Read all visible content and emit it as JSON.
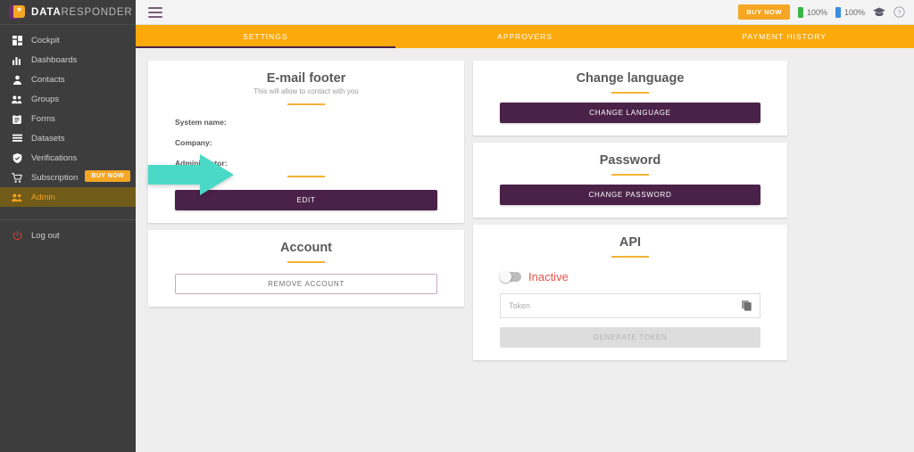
{
  "brand": {
    "name_bold": "DATA",
    "name_light": "RESPONDER",
    "logo_icon": "head-star-logo-icon"
  },
  "sidebar": {
    "items": [
      {
        "label": "Cockpit",
        "icon": "dashboard-grid-icon",
        "active": false
      },
      {
        "label": "Dashboards",
        "icon": "bar-chart-icon",
        "active": false
      },
      {
        "label": "Contacts",
        "icon": "person-icon",
        "active": false
      },
      {
        "label": "Groups",
        "icon": "people-group-icon",
        "active": false
      },
      {
        "label": "Forms",
        "icon": "clipboard-icon",
        "active": false
      },
      {
        "label": "Datasets",
        "icon": "list-lines-icon",
        "active": false
      },
      {
        "label": "Verifications",
        "icon": "shield-check-icon",
        "active": false
      },
      {
        "label": "Subscription",
        "icon": "shopping-cart-icon",
        "active": false,
        "badge": "BUY NOW"
      },
      {
        "label": "Admin",
        "icon": "people-group-icon",
        "active": true
      }
    ],
    "logout": {
      "label": "Log out",
      "icon": "power-icon"
    }
  },
  "topbar": {
    "menu_icon": "hamburger-menu-icon",
    "buy_now_label": "BUY NOW",
    "meters": [
      {
        "value": "100%",
        "color": "#39b54a",
        "icon": "green-battery-icon"
      },
      {
        "value": "100%",
        "color": "#3b8ede",
        "icon": "blue-battery-icon"
      }
    ],
    "graduation_icon": "graduation-cap-icon",
    "help_icon": "help-circle-icon"
  },
  "tabs": [
    {
      "label": "SETTINGS",
      "active": true
    },
    {
      "label": "APPROVERS",
      "active": false
    },
    {
      "label": "PAYMENT HISTORY",
      "active": false
    }
  ],
  "cards": {
    "email_footer": {
      "title": "E-mail footer",
      "subtitle": "This will allow to contact with you",
      "fields": [
        {
          "label": "System name:",
          "value": ""
        },
        {
          "label": "Company:",
          "value": ""
        },
        {
          "label": "Administrator:",
          "value": ""
        }
      ],
      "edit_label": "EDIT"
    },
    "account": {
      "title": "Account",
      "remove_label": "REMOVE ACCOUNT"
    },
    "change_language": {
      "title": "Change language",
      "button_label": "CHANGE LANGUAGE"
    },
    "password": {
      "title": "Password",
      "button_label": "CHANGE PASSWORD"
    },
    "api": {
      "title": "API",
      "toggle_state": "Inactive",
      "toggle_on": false,
      "token_value": "",
      "token_placeholder": "Token",
      "copy_icon": "copy-icon",
      "generate_label": "GENERATE TOKEN",
      "generate_disabled": true
    }
  },
  "annotation": {
    "arrow_icon": "teal-arrow-right-icon",
    "arrow_color": "#4ad9c6",
    "points_at": "EDIT"
  },
  "colors": {
    "accent_orange": "#fca90c",
    "brand_purple": "#4a2249",
    "sidebar_bg": "#3d3d3d",
    "page_bg": "#eeeeee",
    "rule_gold": "#f5b335",
    "inactive_red": "#e8534a"
  }
}
